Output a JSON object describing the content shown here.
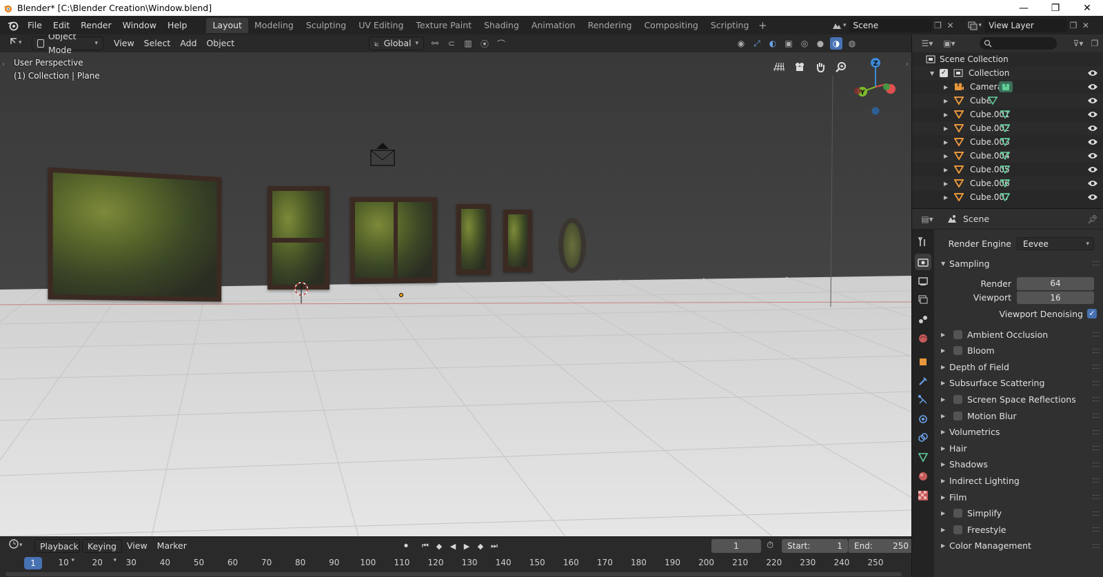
{
  "window": {
    "title": "Blender* [C:\\Blender Creation\\Window.blend]",
    "controls": [
      "—",
      "❐",
      "✕"
    ]
  },
  "menu": [
    "File",
    "Edit",
    "Render",
    "Window",
    "Help"
  ],
  "workspaces": {
    "tabs": [
      "Layout",
      "Modeling",
      "Sculpting",
      "UV Editing",
      "Texture Paint",
      "Shading",
      "Animation",
      "Rendering",
      "Compositing",
      "Scripting"
    ],
    "add": "+",
    "active": "Layout"
  },
  "scene_selector": {
    "value": "Scene"
  },
  "view_layer_selector": {
    "value": "View Layer"
  },
  "viewport": {
    "mode": "Object Mode",
    "menus": [
      "View",
      "Select",
      "Add",
      "Object"
    ],
    "transform_orientation": "Global",
    "overlay_line1": "User Perspective",
    "overlay_line2": "(1) Collection | Plane",
    "gizmo_axes": {
      "z": "Z",
      "y": "Y"
    }
  },
  "outliner": {
    "root": "Scene Collection",
    "collection": "Collection",
    "items": [
      "Camera",
      "Cube",
      "Cube.001",
      "Cube.002",
      "Cube.003",
      "Cube.004",
      "Cube.005",
      "Cube.006",
      "Cube.007"
    ]
  },
  "properties": {
    "context": "Scene",
    "render_engine_label": "Render Engine",
    "render_engine_value": "Eevee",
    "sampling": {
      "title": "Sampling",
      "render_label": "Render",
      "render_value": "64",
      "viewport_label": "Viewport",
      "viewport_value": "16",
      "denoise_label": "Viewport Denoising",
      "denoise_checked": true
    },
    "panels": [
      {
        "label": "Ambient Occlusion",
        "checkbox": true
      },
      {
        "label": "Bloom",
        "checkbox": true
      },
      {
        "label": "Depth of Field",
        "checkbox": false
      },
      {
        "label": "Subsurface Scattering",
        "checkbox": false
      },
      {
        "label": "Screen Space Reflections",
        "checkbox": true
      },
      {
        "label": "Motion Blur",
        "checkbox": true
      },
      {
        "label": "Volumetrics",
        "checkbox": false
      },
      {
        "label": "Hair",
        "checkbox": false
      },
      {
        "label": "Shadows",
        "checkbox": false
      },
      {
        "label": "Indirect Lighting",
        "checkbox": false
      },
      {
        "label": "Film",
        "checkbox": false
      },
      {
        "label": "Simplify",
        "checkbox": true
      },
      {
        "label": "Freestyle",
        "checkbox": true
      },
      {
        "label": "Color Management",
        "checkbox": false
      }
    ]
  },
  "timeline": {
    "menus": [
      "Playback",
      "Keying",
      "View",
      "Marker"
    ],
    "current_frame": "1",
    "start_label": "Start:",
    "start_value": "1",
    "end_label": "End:",
    "end_value": "250",
    "ruler": [
      "1",
      "10",
      "20",
      "30",
      "40",
      "50",
      "60",
      "70",
      "80",
      "90",
      "100",
      "110",
      "120",
      "130",
      "140",
      "150",
      "160",
      "170",
      "180",
      "190",
      "200",
      "210",
      "220",
      "230",
      "240",
      "250"
    ]
  },
  "colors": {
    "accent": "#4772b3",
    "axis_x": "#e14f4f",
    "axis_y": "#7dbb2a",
    "axis_z": "#3d8ad8",
    "object_orange": "#e8963b",
    "mesh_green": "#5fd09a"
  }
}
